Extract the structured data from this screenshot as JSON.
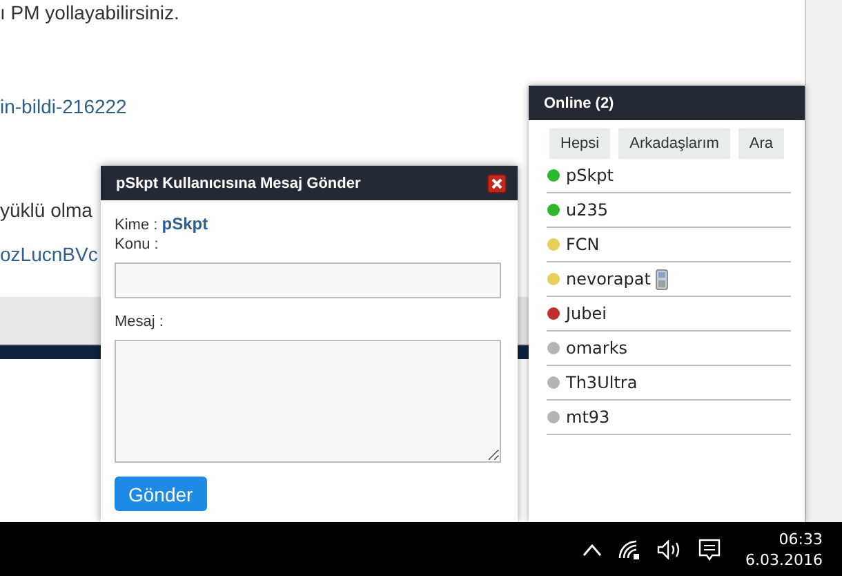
{
  "page": {
    "lines": [
      {
        "kind": "text",
        "text": "ı PM yollayabilirsiniz."
      },
      {
        "kind": "link",
        "text": "in-bildi-216222"
      },
      {
        "kind": "text",
        "text": "yüklü olma"
      },
      {
        "kind": "link",
        "text": "ozLucnBVc"
      }
    ]
  },
  "dialog": {
    "title": "pSkpt Kullanıcısına Mesaj Gönder",
    "to_label": "Kime :",
    "to_value": "pSkpt",
    "subject_label": "Konu :",
    "message_label": "Mesaj :",
    "send_button": "Gönder"
  },
  "online_panel": {
    "title": "Online (2)",
    "filters": [
      "Hepsi",
      "Arkadaşlarım",
      "Ara"
    ],
    "users": [
      {
        "name": "pSkpt",
        "color": "#2db92d",
        "mobile": false
      },
      {
        "name": "u235",
        "color": "#2db92d",
        "mobile": false
      },
      {
        "name": "FCN",
        "color": "#e6d05a",
        "mobile": false
      },
      {
        "name": "nevorapat",
        "color": "#e6d05a",
        "mobile": true
      },
      {
        "name": "Jubei",
        "color": "#c0302a",
        "mobile": false
      },
      {
        "name": "omarks",
        "color": "#b4b4b4",
        "mobile": false
      },
      {
        "name": "Th3Ultra",
        "color": "#b4b4b4",
        "mobile": false
      },
      {
        "name": "mt93",
        "color": "#b4b4b4",
        "mobile": false
      }
    ]
  },
  "taskbar": {
    "time": "06:33",
    "date": "6.03.2016"
  }
}
